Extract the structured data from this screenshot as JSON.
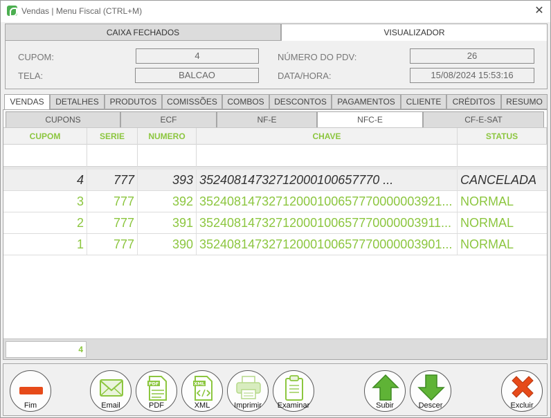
{
  "window": {
    "title": "Vendas | Menu Fiscal (CTRL+M)",
    "close": "✕"
  },
  "top_tabs": [
    {
      "label": "CAIXA FECHADOS",
      "active": false
    },
    {
      "label": "VISUALIZADOR",
      "active": true
    }
  ],
  "info": {
    "cupom_label": "CUPOM:",
    "cupom_value": "4",
    "tela_label": "TELA:",
    "tela_value": "BALCAO",
    "pdv_label": "NÚMERO DO PDV:",
    "pdv_value": "26",
    "datahora_label": "DATA/HORA:",
    "datahora_value": "15/08/2024 15:53:16"
  },
  "main_tabs": [
    "VENDAS",
    "DETALHES",
    "PRODUTOS",
    "COMISSÕES",
    "COMBOS",
    "DESCONTOS",
    "PAGAMENTOS",
    "CLIENTE",
    "CRÉDITOS",
    "RESUMO"
  ],
  "main_tab_active": "VENDAS",
  "sub_tabs": [
    "CUPONS",
    "ECF",
    "NF-E",
    "NFC-E",
    "CF-E-SAT"
  ],
  "sub_tab_active": "NFC-E",
  "grid": {
    "columns": [
      "CUPOM",
      "SERIE",
      "NUMERO",
      "CHAVE",
      "STATUS"
    ],
    "rows": [
      {
        "cupom": "4",
        "serie": "777",
        "numero": "393",
        "chave": "35240814732712000100657770 ...",
        "status": "CANCELADA",
        "cancelled": true
      },
      {
        "cupom": "3",
        "serie": "777",
        "numero": "392",
        "chave": "35240814732712000100657770000003921...",
        "status": "NORMAL",
        "cancelled": false
      },
      {
        "cupom": "2",
        "serie": "777",
        "numero": "391",
        "chave": "35240814732712000100657770000003911...",
        "status": "NORMAL",
        "cancelled": false
      },
      {
        "cupom": "1",
        "serie": "777",
        "numero": "390",
        "chave": "35240814732712000100657770000003901...",
        "status": "NORMAL",
        "cancelled": false
      }
    ],
    "count": "4"
  },
  "toolbar": {
    "fim": "Fim",
    "email": "Email",
    "pdf": "PDF",
    "xml": "XML",
    "imprimir": "Imprimir",
    "examinar": "Examinar",
    "subir": "Subir",
    "descer": "Descer",
    "excluir": "Excluir"
  },
  "colors": {
    "accent_green": "#8cc63f",
    "danger_red": "#e64a19",
    "arrow_green": "#5fb336"
  }
}
